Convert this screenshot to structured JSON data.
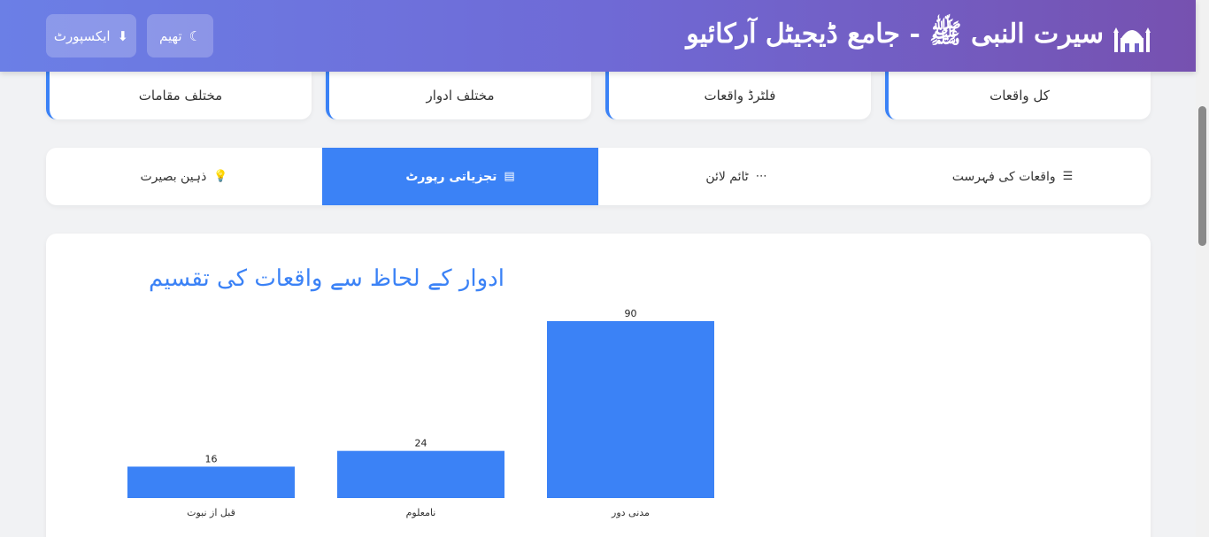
{
  "header": {
    "title": "سیرت النبی ﷺ - جامع ڈیجیٹل آرکائیو",
    "theme_button": "تھیم",
    "export_button": "ایکسپورٹ"
  },
  "stats": [
    {
      "label": "کل واقعات"
    },
    {
      "label": "فلٹرڈ واقعات"
    },
    {
      "label": "مختلف ادوار"
    },
    {
      "label": "مختلف مقامات"
    }
  ],
  "tabs": [
    {
      "label": "واقعات کی فہرست",
      "icon": "list-icon",
      "active": false
    },
    {
      "label": "ٹائم لائن",
      "icon": "timeline-icon",
      "active": false
    },
    {
      "label": "تجزیاتی رپورٹ",
      "icon": "chart-icon",
      "active": true
    },
    {
      "label": "ذہین بصیرت",
      "icon": "lightbulb-icon",
      "active": false
    }
  ],
  "colors": {
    "accent": "#3b82f6",
    "header_start": "#6b7fe6",
    "header_end": "#7651b0"
  },
  "chart_data": {
    "type": "bar",
    "title": "ادوار کے لحاظ سے واقعات کی تقسیم",
    "categories": [
      "قبل از نبوت",
      "نامعلوم",
      "مدنی دور"
    ],
    "values": [
      16,
      24,
      90
    ],
    "ylim": [
      0,
      90
    ],
    "grid": false,
    "legend": "none"
  }
}
